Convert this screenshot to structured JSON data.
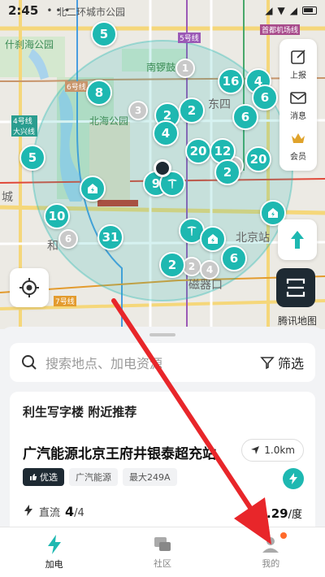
{
  "status_bar": {
    "time": "2:45"
  },
  "map": {
    "labels": {
      "road_north": "北二环城市公园",
      "shichahai": "什刹海公园",
      "nanluogu": "南锣鼓",
      "dongsi": "东四",
      "beihai": "北海公园",
      "line6": "6号线",
      "line4": "4号线 大兴线",
      "line5": "5号线",
      "airport": "首都机场线",
      "line7": "7号线",
      "beijing_station": "北京站",
      "ciqikou": "磁器口",
      "cheng": "城",
      "xi": "和"
    },
    "clusters": [
      "5",
      "8",
      "2",
      "2",
      "16",
      "4",
      "6",
      "4",
      "20",
      "12",
      "2",
      "20",
      "5",
      "10",
      "31",
      "6",
      "2",
      "6",
      "1",
      "3",
      "9"
    ],
    "gray_clusters": [
      "1",
      "3",
      "6",
      "2",
      "4",
      "2"
    ]
  },
  "side_tools": {
    "report": "上报",
    "message": "消息",
    "vip": "会员"
  },
  "attribution": "腾讯地图",
  "search": {
    "placeholder": "搜索地点、加电资源",
    "filter_label": "筛选"
  },
  "recommend": {
    "heading": "利生写字楼 附近推荐",
    "station_name": "广汽能源北京王府井银泰超充站",
    "distance": "1.0km",
    "tags": [
      "优选",
      "广汽能源",
      "最大249A"
    ],
    "charge_type": "直流",
    "available": "4",
    "total": "/4",
    "price": "¥1.29",
    "price_unit": "/度"
  },
  "tabs": {
    "charge": "加电",
    "community": "社区",
    "mine": "我的"
  },
  "colors": {
    "accent": "#1eb8b1",
    "dark": "#1e2a33",
    "arrow": "#e8262a"
  }
}
